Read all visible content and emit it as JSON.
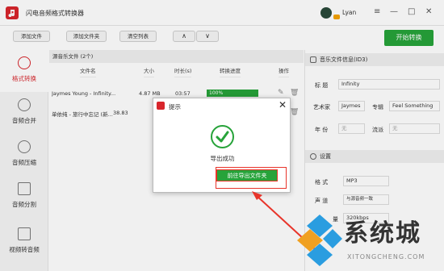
{
  "app": {
    "title": "闪电音频格式转换器",
    "user": "Lyan"
  },
  "window_controls": [
    "≡",
    "—",
    "□",
    "✕"
  ],
  "toolbar": {
    "add_file": "添加文件",
    "add_folder": "添加文件夹",
    "clear_list": "清空列表",
    "move_up": "∧",
    "move_down": "∨",
    "start": "开始转换"
  },
  "sidebar": {
    "items": [
      {
        "label": "格式转换",
        "icon": "refresh-icon"
      },
      {
        "label": "音频合并",
        "icon": "merge-icon"
      },
      {
        "label": "音频压缩",
        "icon": "compress-icon"
      },
      {
        "label": "音频分割",
        "icon": "split-icon"
      },
      {
        "label": "视频转音频",
        "icon": "video-icon"
      }
    ]
  },
  "files": {
    "header": "源音乐文件 (2个)",
    "columns": [
      "文件名",
      "大小",
      "时长(s)",
      "转换进度",
      "操作"
    ],
    "rows": [
      {
        "name": "Jaymes Young - Infinity...",
        "size": "4.87 MB",
        "duration": "03:57",
        "progress": "100%"
      },
      {
        "name": "单依纯 - 旅行中忘记 (新...",
        "size": "38.83",
        "duration": "",
        "progress": ""
      }
    ]
  },
  "id3": {
    "section": "音乐文件信息(ID3)",
    "title_label": "标  题",
    "title_value": "Infinity",
    "artist_label": "艺术家",
    "artist_value": "Jaymes",
    "album_label": "专辑",
    "album_value": "Feel Something",
    "year_label": "年  份",
    "year_value": "无",
    "genre_label": "流派",
    "genre_value": "无"
  },
  "settings": {
    "section": "设置",
    "format_label": "格  式",
    "format_value": "MP3",
    "channel_label": "声  道",
    "channel_value": "与源音频一致",
    "quality_label": "量",
    "quality_value": "320kbps"
  },
  "dialog": {
    "title": "提示",
    "close": "✕",
    "message": "导出成功",
    "button": "前往导出文件夹"
  },
  "watermark": {
    "text": "系统城",
    "sub": "XITONGCHENG.COM"
  },
  "colors": {
    "accent_green": "#27a33a",
    "brand_red": "#d8262c",
    "highlight_red": "#e8342a"
  }
}
